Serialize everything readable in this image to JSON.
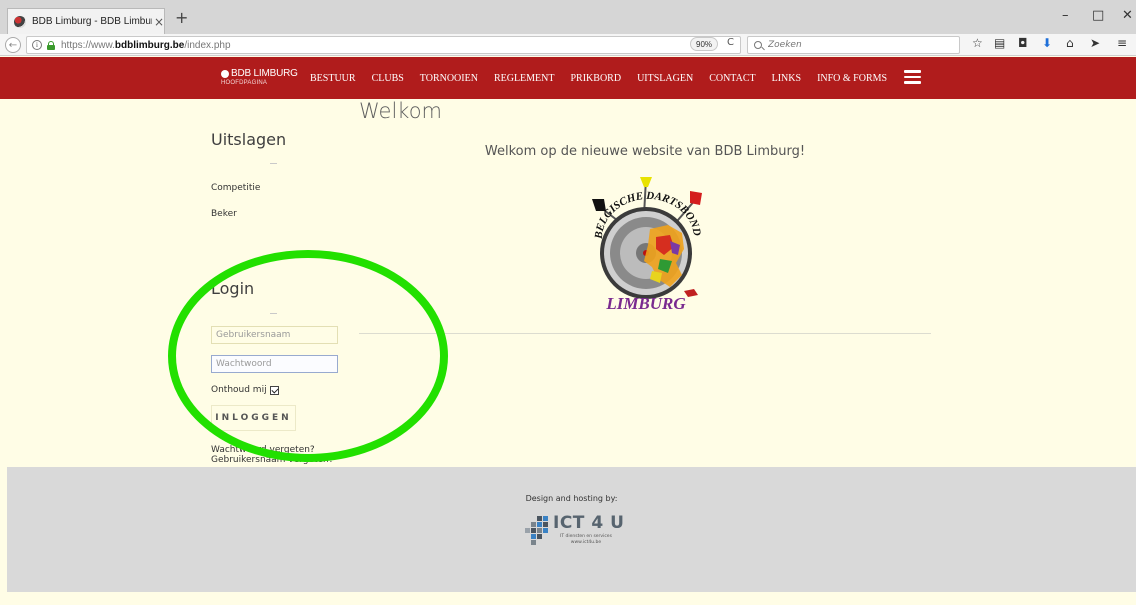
{
  "browser": {
    "tab_title": "BDB Limburg - BDB Limburg",
    "url_prefix": "https://www.",
    "url_domain": "bdblimburg.be",
    "url_path": "/index.php",
    "zoom": "90%",
    "search_placeholder": "Zoeken",
    "window_controls": [
      "–",
      "□",
      "✕"
    ]
  },
  "header": {
    "logo_main": "BDB LIMBURG",
    "logo_sub": "HOOFDPAGINA",
    "menu": [
      "BESTUUR",
      "CLUBS",
      "TORNOOIEN",
      "REGLEMENT",
      "PRIKBORD",
      "UITSLAGEN",
      "CONTACT",
      "LINKS",
      "INFO & FORMS"
    ]
  },
  "main": {
    "title": "Welkom",
    "welcome_text": "Welkom op de nieuwe website van BDB Limburg!",
    "emblem_top": "BELGISCHE DARTSBOND",
    "emblem_bottom": "LIMBURG"
  },
  "sidebar": {
    "results_title": "Uitslagen",
    "results_links": [
      "Competitie",
      "Beker"
    ],
    "login_title": "Login",
    "username_placeholder": "Gebruikersnaam",
    "password_placeholder": "Wachtwoord",
    "remember_label": "Onthoud mij",
    "login_button": "INLOGGEN",
    "forgot_password": "Wachtwoord vergeten?",
    "forgot_username": "Gebruikersnaam vergeten?"
  },
  "annotation": {
    "color": "#22e000"
  },
  "footer": {
    "credit": "Design and hosting by:",
    "company": "ICT 4 U",
    "company_tagline": "IT diensten en services",
    "company_url": "www.ict4u.be"
  },
  "colors": {
    "brand_red": "#b01c1c",
    "page_bg": "#fffde6",
    "footer_bg": "#d9d9d9"
  }
}
